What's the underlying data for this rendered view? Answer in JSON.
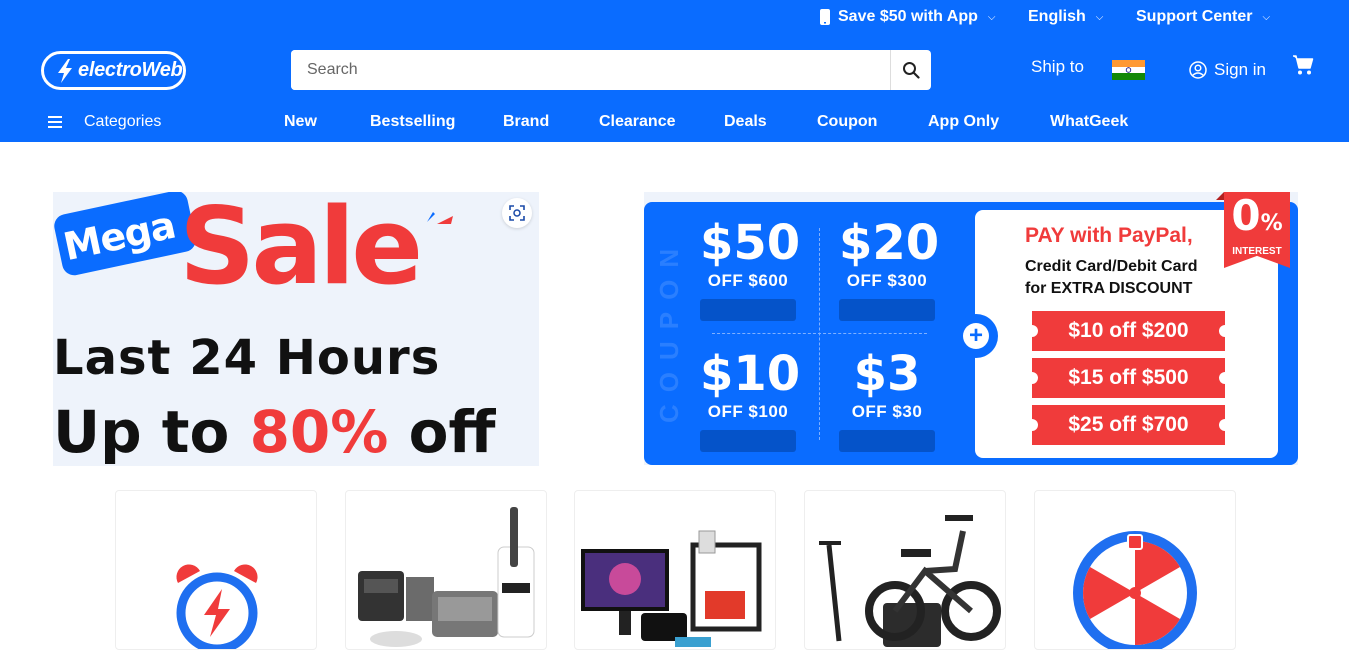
{
  "topbar": {
    "app_promo": "Save $50 with App",
    "language": "English",
    "support": "Support Center"
  },
  "logo": {
    "text": "electroWeb"
  },
  "search": {
    "placeholder": "Search"
  },
  "ship": {
    "label": "Ship to",
    "country_flag": "india-flag-icon"
  },
  "account": {
    "signin_label": "Sign in"
  },
  "nav": {
    "categories_label": "Categories",
    "items": [
      "New",
      "Bestselling",
      "Brand",
      "Clearance",
      "Deals",
      "Coupon",
      "App Only",
      "WhatGeek"
    ]
  },
  "mega_banner": {
    "badge": "Mega",
    "headline": "Sale",
    "line1": "Last 24 Hours",
    "line2_prefix": "Up to ",
    "line2_highlight": "80%",
    "line2_suffix": " off"
  },
  "coupon_banner": {
    "side_label": "COUPON",
    "coupons": [
      {
        "amount": "$50",
        "condition": "OFF $600"
      },
      {
        "amount": "$20",
        "condition": "OFF $300"
      },
      {
        "amount": "$10",
        "condition": "OFF $100"
      },
      {
        "amount": "$3",
        "condition": "OFF $30"
      }
    ],
    "paypal_title": "PAY with PayPal,",
    "paypal_line1": "Credit Card/Debit Card",
    "paypal_line2": "for EXTRA DISCOUNT",
    "discounts": [
      "$10 off $200",
      "$15 off $500",
      "$25 off $700"
    ],
    "ribbon_value": "0",
    "ribbon_unit": "%",
    "ribbon_label": "INTEREST"
  },
  "tiles": [
    {
      "name": "flash-deals-tile",
      "icon": "alarm-clock-lightning-icon"
    },
    {
      "name": "home-appliances-tile",
      "icon": "appliances-image"
    },
    {
      "name": "electronics-tile",
      "icon": "monitor-3d-printer-image"
    },
    {
      "name": "e-mobility-tile",
      "icon": "scooter-ebike-image"
    },
    {
      "name": "lucky-wheel-tile",
      "icon": "prize-wheel-icon"
    }
  ],
  "colors": {
    "brand_blue": "#0a6cff",
    "accent_red": "#f03b3b",
    "dark_blue": "#0553c9",
    "banner_bg": "#eef3fb"
  }
}
